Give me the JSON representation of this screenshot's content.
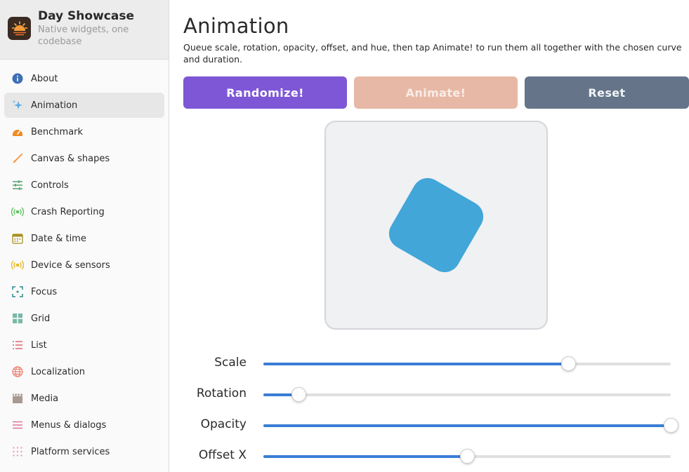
{
  "app": {
    "title": "Day Showcase",
    "subtitle": "Native widgets, one codebase",
    "icon": "sunrise-icon"
  },
  "sidebar": {
    "items": [
      {
        "label": "About",
        "icon": "info-icon",
        "color": "#3f6fb5"
      },
      {
        "label": "Animation",
        "icon": "sparkles-icon",
        "color": "#5aa9e6",
        "active": true
      },
      {
        "label": "Benchmark",
        "icon": "speedometer-icon",
        "color": "#f08a24"
      },
      {
        "label": "Canvas & shapes",
        "icon": "brush-icon",
        "color": "#f5a25d"
      },
      {
        "label": "Controls",
        "icon": "sliders-icon",
        "color": "#4a9a5c"
      },
      {
        "label": "Crash Reporting",
        "icon": "broadcast-icon",
        "color": "#5cc45c"
      },
      {
        "label": "Date & time",
        "icon": "calendar-icon",
        "color": "#a8901e"
      },
      {
        "label": "Device & sensors",
        "icon": "sensor-icon",
        "color": "#e8b820"
      },
      {
        "label": "Focus",
        "icon": "focus-icon",
        "color": "#2b8a8a"
      },
      {
        "label": "Grid",
        "icon": "grid-icon",
        "color": "#7ab8a8"
      },
      {
        "label": "List",
        "icon": "list-icon",
        "color": "#e05a6a"
      },
      {
        "label": "Localization",
        "icon": "globe-icon",
        "color": "#e88070"
      },
      {
        "label": "Media",
        "icon": "clapperboard-icon",
        "color": "#a89a90"
      },
      {
        "label": "Menus & dialogs",
        "icon": "menu-icon",
        "color": "#e06a8a"
      },
      {
        "label": "Platform services",
        "icon": "dots-grid-icon",
        "color": "#f0a0b0"
      }
    ]
  },
  "main": {
    "title": "Animation",
    "description": "Queue scale, rotation, opacity, offset, and hue, then tap Animate! to run them all together with the chosen curve and duration.",
    "buttons": {
      "randomize": "Randomize!",
      "animate": "Animate!",
      "reset": "Reset"
    },
    "shape": {
      "color": "#42a6d9",
      "rotation_deg": 30
    },
    "controls": [
      {
        "label": "Scale",
        "value_fraction": 0.748
      },
      {
        "label": "Rotation",
        "value_fraction": 0.086
      },
      {
        "label": "Opacity",
        "value_fraction": 1.0
      },
      {
        "label": "Offset X",
        "value_fraction": 0.5
      }
    ]
  }
}
